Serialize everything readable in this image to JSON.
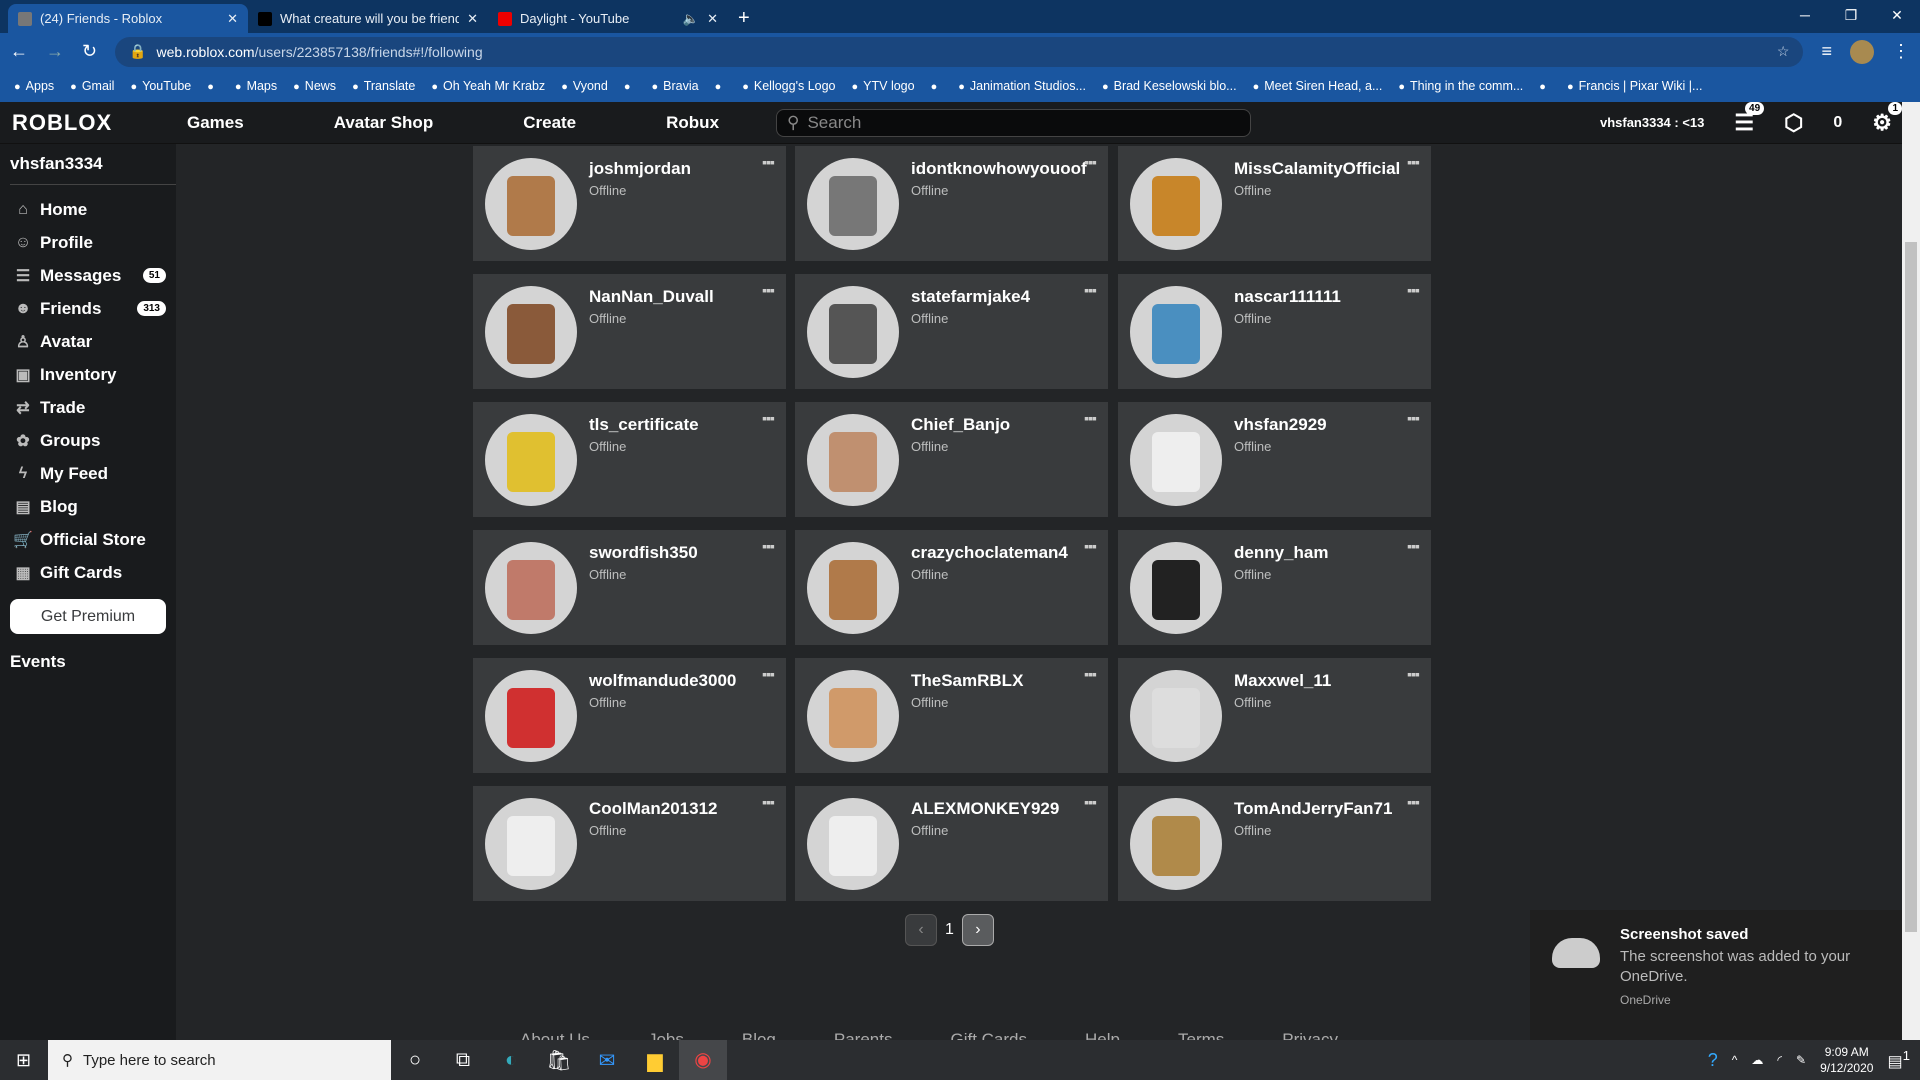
{
  "browser": {
    "tabs": [
      {
        "title": "(24) Friends - Roblox",
        "active": true
      },
      {
        "title": "What creature will you be friends"
      },
      {
        "title": "Daylight - YouTube"
      }
    ],
    "url_host": "web.roblox.com",
    "url_path": "/users/223857138/friends#!/following",
    "bookmarks": [
      "Apps",
      "Gmail",
      "YouTube",
      "",
      "Maps",
      "News",
      "Translate",
      "Oh Yeah Mr Krabz",
      "Vyond",
      "",
      "Bravia",
      "",
      "Kellogg's Logo",
      "YTV logo",
      "",
      "Janimation Studios...",
      "Brad Keselowski blo...",
      "Meet Siren Head, a...",
      "Thing in the comm...",
      "",
      "Francis | Pixar Wiki |..."
    ]
  },
  "nav": {
    "logo": "ROBLOX",
    "links": [
      "Games",
      "Avatar Shop",
      "Create",
      "Robux"
    ],
    "search_placeholder": "Search",
    "user": "vhsfan3334 : <13",
    "messages_badge": "49",
    "robux": "0",
    "settings_badge": "1"
  },
  "sidebar": {
    "username": "vhsfan3334",
    "items": [
      {
        "label": "Home",
        "icon": "⌂"
      },
      {
        "label": "Profile",
        "icon": "☺"
      },
      {
        "label": "Messages",
        "icon": "☰",
        "count": "51"
      },
      {
        "label": "Friends",
        "icon": "☻",
        "count": "313"
      },
      {
        "label": "Avatar",
        "icon": "♙"
      },
      {
        "label": "Inventory",
        "icon": "▣"
      },
      {
        "label": "Trade",
        "icon": "⇄"
      },
      {
        "label": "Groups",
        "icon": "✿"
      },
      {
        "label": "My Feed",
        "icon": "ϟ"
      },
      {
        "label": "Blog",
        "icon": "▤"
      },
      {
        "label": "Official Store",
        "icon": "🛒"
      },
      {
        "label": "Gift Cards",
        "icon": "▦"
      }
    ],
    "premium": "Get Premium",
    "events": "Events"
  },
  "friends": [
    {
      "name": "joshmjordan",
      "status": "Offline",
      "color": "#b07a4a"
    },
    {
      "name": "idontknowhowyouoof",
      "status": "Offline",
      "color": "#777"
    },
    {
      "name": "MissCalamityOfficial",
      "status": "Offline",
      "color": "#c8862a"
    },
    {
      "name": "NanNan_Duvall",
      "status": "Offline",
      "color": "#8a5a3a"
    },
    {
      "name": "statefarmjake4",
      "status": "Offline",
      "color": "#555"
    },
    {
      "name": "nascar111111",
      "status": "Offline",
      "color": "#4a8fc0"
    },
    {
      "name": "tls_certificate",
      "status": "Offline",
      "color": "#e0c030"
    },
    {
      "name": "Chief_Banjo",
      "status": "Offline",
      "color": "#c09070"
    },
    {
      "name": "vhsfan2929",
      "status": "Offline",
      "color": "#eee"
    },
    {
      "name": "swordfish350",
      "status": "Offline",
      "color": "#c07a6a"
    },
    {
      "name": "crazychoclateman4",
      "status": "Offline",
      "color": "#b07a4a"
    },
    {
      "name": "denny_ham",
      "status": "Offline",
      "color": "#222"
    },
    {
      "name": "wolfmandude3000",
      "status": "Offline",
      "color": "#d03030"
    },
    {
      "name": "TheSamRBLX",
      "status": "Offline",
      "color": "#d09a6a"
    },
    {
      "name": "Maxxwel_11",
      "status": "Offline",
      "color": "#ddd"
    },
    {
      "name": "CoolMan201312",
      "status": "Offline",
      "color": "#eee"
    },
    {
      "name": "ALEXMONKEY929",
      "status": "Offline",
      "color": "#eee"
    },
    {
      "name": "TomAndJerryFan71",
      "status": "Offline",
      "color": "#b08a4a"
    }
  ],
  "pager": {
    "page": "1",
    "prev": "‹",
    "next": "›"
  },
  "footer": [
    "About Us",
    "Jobs",
    "Blog",
    "Parents",
    "Gift Cards",
    "Help",
    "Terms",
    "Privacy"
  ],
  "toast": {
    "title": "Screenshot saved",
    "body": "The screenshot was added to your OneDrive.",
    "source": "OneDrive"
  },
  "taskbar": {
    "search_placeholder": "Type here to search",
    "time": "9:09 AM",
    "date": "9/12/2020",
    "notif": "1"
  }
}
